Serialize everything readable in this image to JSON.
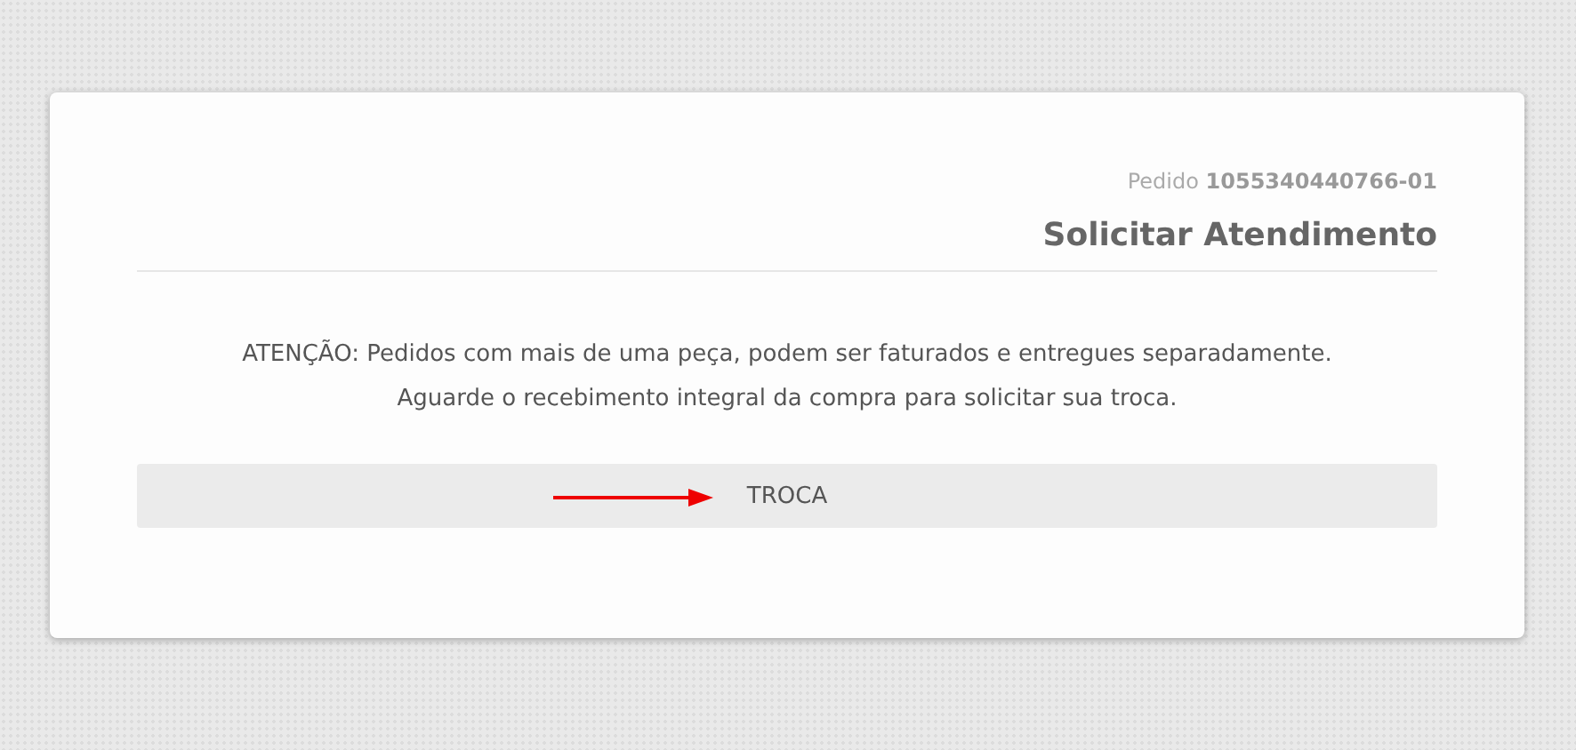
{
  "order": "Pedido **1055340440766-01**",
  "title": "Solicitar Atendimento",
  "notice": [
    "ATENÇÃO: Pedidos com mais de uma peça, podem ser faturados e entregues separadamente.",
    "Aguarde o recebimento integral da compra para solicitar sua troca."
  ],
  "buttons": [
    {
      "label": "TROCA",
      "highlighted": true
    }
  ]
}
